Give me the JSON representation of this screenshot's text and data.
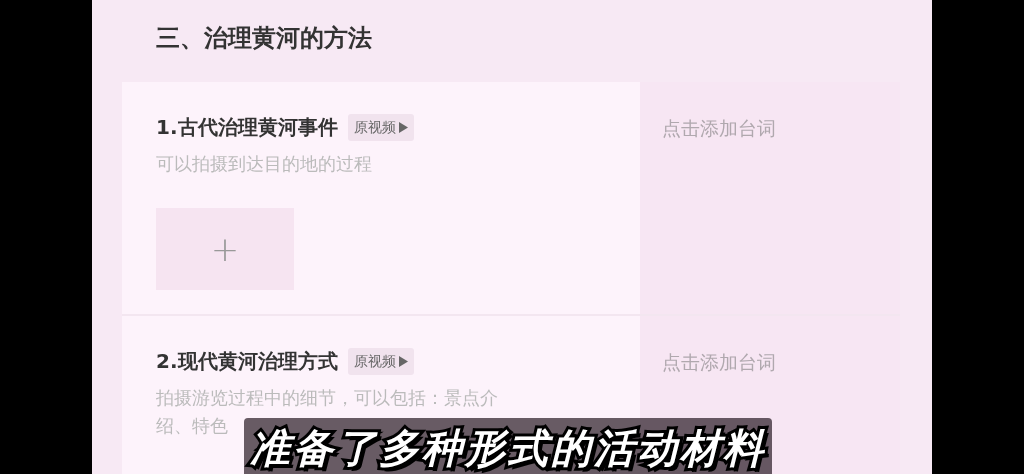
{
  "section": {
    "title": "三、治理黄河的方法"
  },
  "items": [
    {
      "title": "1.古代治理黄河事件",
      "tag": "原视频",
      "description": [
        "可以拍摄到达目的地的过程"
      ],
      "add_button": "+",
      "lines_hint": "点击添加台词"
    },
    {
      "title": "2.现代黄河治理方式",
      "tag": "原视频",
      "description": [
        "拍摄游览过程中的细节，可以包括：景点介",
        "绍、特色"
      ],
      "lines_hint": "点击添加台词"
    }
  ],
  "subtitle": "准备了多种形式的活动材料"
}
